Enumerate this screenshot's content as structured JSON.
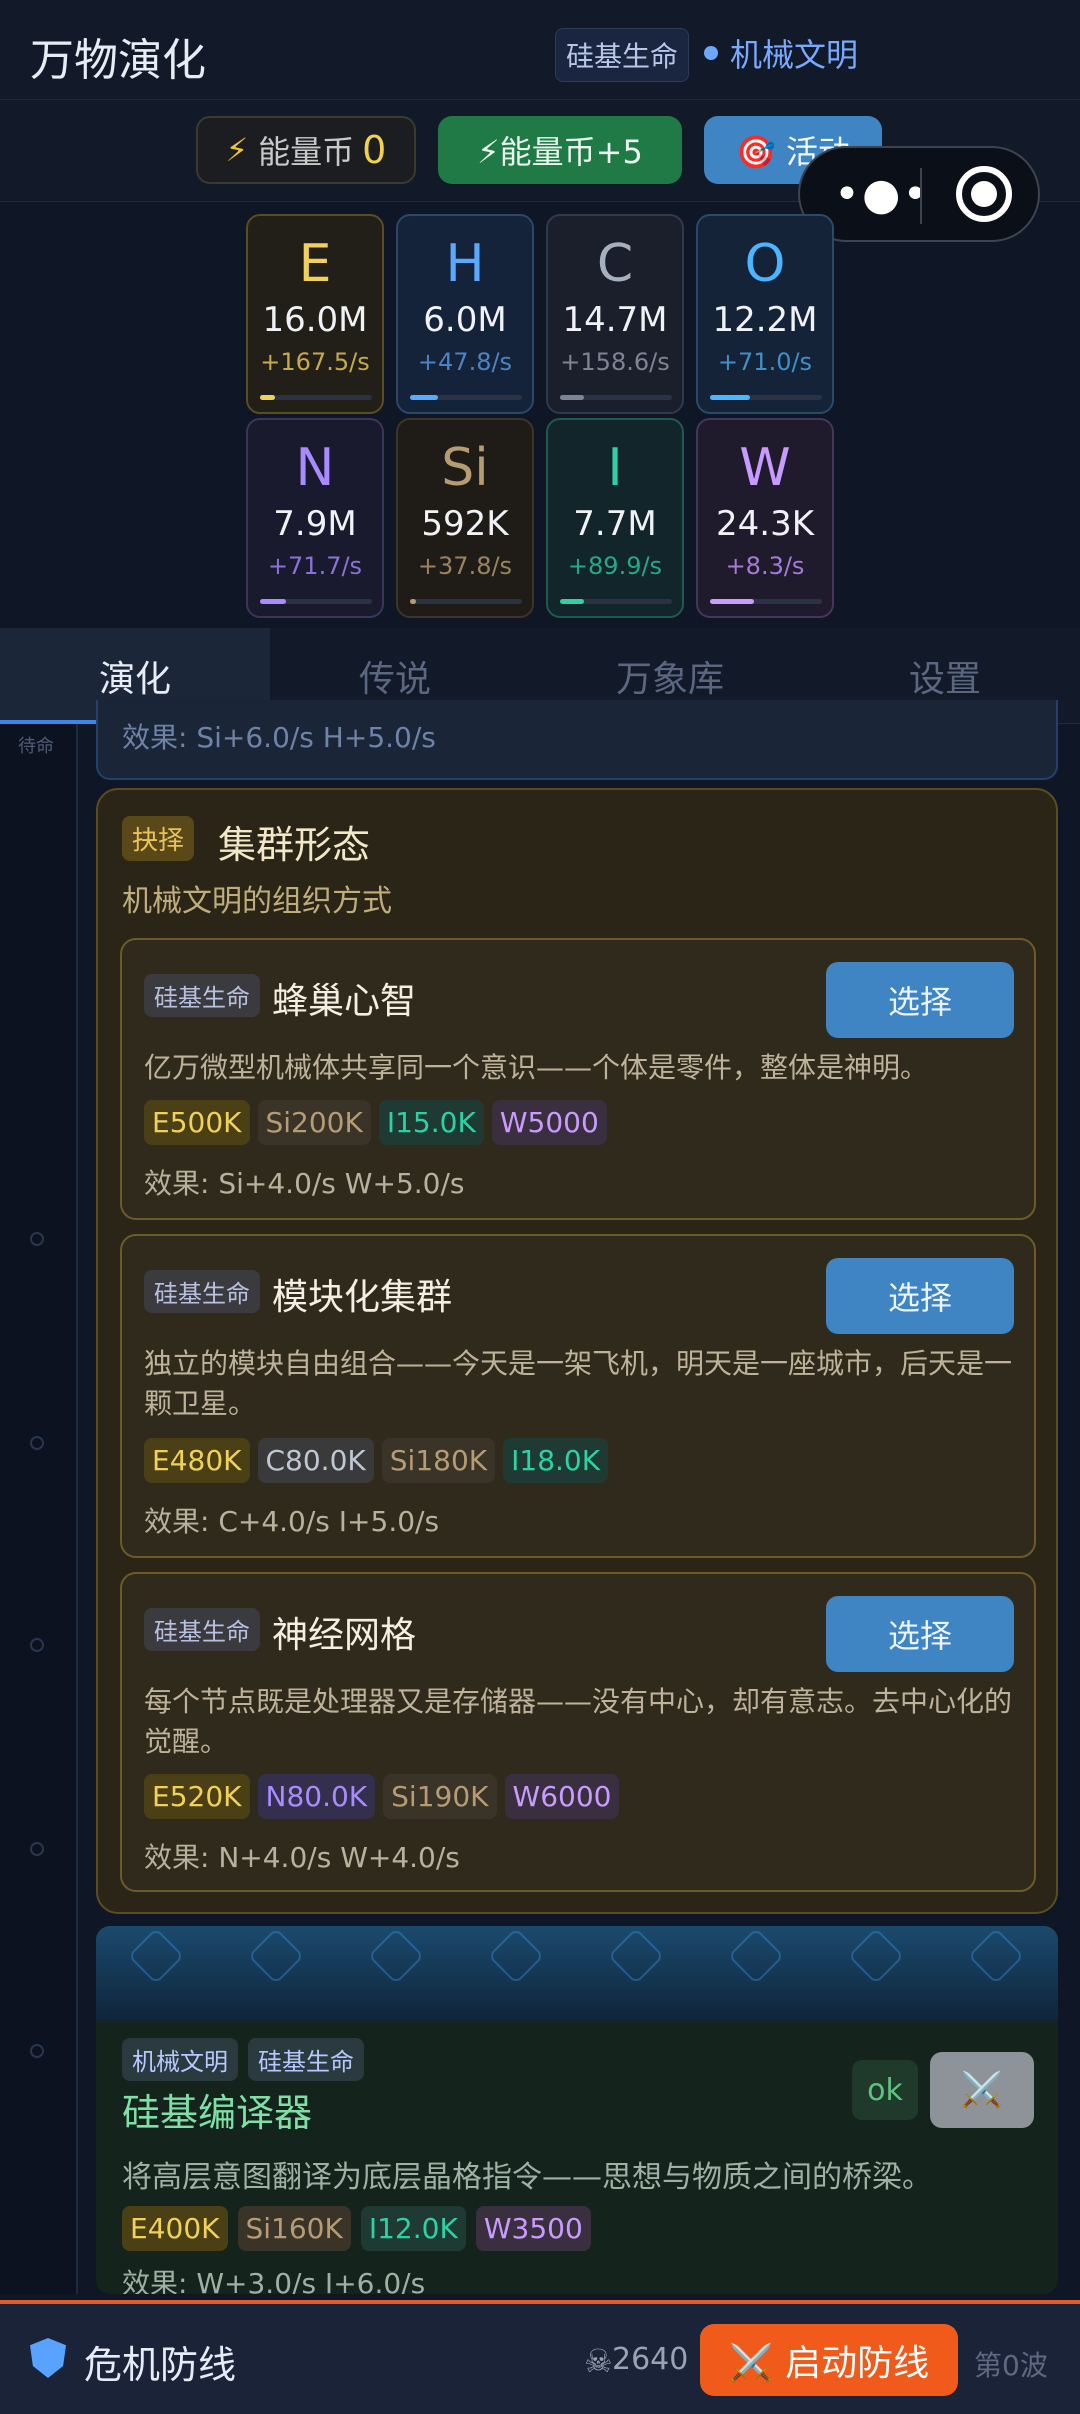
{
  "header": {
    "title": "万物演化",
    "tag": "硅基生命",
    "civ": "机械文明"
  },
  "topbar": {
    "energy_label": "能量币",
    "energy_value": "0",
    "plus_label": "⚡能量币+5",
    "activity_label": "🎯 活动"
  },
  "resources": [
    {
      "symbol": "E",
      "amount": "16.0M",
      "rate": "+167.5/s",
      "color": "#f0d25a",
      "fill": 0.12
    },
    {
      "symbol": "H",
      "amount": "6.0M",
      "rate": "+47.8/s",
      "color": "#5aa9ff",
      "fill": 0.12
    },
    {
      "symbol": "C",
      "amount": "14.7M",
      "rate": "+158.6/s",
      "color": "#a7b0bf",
      "fill": 0.12
    },
    {
      "symbol": "O",
      "amount": "12.2M",
      "rate": "+71.0/s",
      "color": "#4bb6ff",
      "fill": 0.2
    },
    {
      "symbol": "N",
      "amount": "7.9M",
      "rate": "+71.7/s",
      "color": "#a88bff",
      "fill": 0.12
    },
    {
      "symbol": "Si",
      "amount": "592K",
      "rate": "+37.8/s",
      "color": "#b59c72",
      "fill": 0.04
    },
    {
      "symbol": "I",
      "amount": "7.7M",
      "rate": "+89.9/s",
      "color": "#2ed1a6",
      "fill": 0.12
    },
    {
      "symbol": "W",
      "amount": "24.3K",
      "rate": "+8.3/s",
      "color": "#c99bff",
      "fill": 0.24
    }
  ],
  "tabs": [
    "演化",
    "传说",
    "万象库",
    "设置"
  ],
  "side": {
    "wait": "待命"
  },
  "prev": {
    "effect": "效果: Si+6.0/s  H+5.0/s"
  },
  "choice": {
    "tag": "抉择",
    "title": "集群形态",
    "desc": "机械文明的组织方式",
    "options": [
      {
        "civ": "硅基生命",
        "name": "蜂巢心智",
        "button": "选择",
        "text": "亿万微型机械体共享同一个意识——个体是零件，整体是神明。",
        "costs": [
          "E500K",
          "Si200K",
          "I15.0K",
          "W5000"
        ],
        "effect": "效果: Si+4.0/s  W+5.0/s"
      },
      {
        "civ": "硅基生命",
        "name": "模块化集群",
        "button": "选择",
        "text": "独立的模块自由组合——今天是一架飞机，明天是一座城市，后天是一颗卫星。",
        "costs": [
          "E480K",
          "C80.0K",
          "Si180K",
          "I18.0K"
        ],
        "effect": "效果: C+4.0/s  I+5.0/s"
      },
      {
        "civ": "硅基生命",
        "name": "神经网格",
        "button": "选择",
        "text": "每个节点既是处理器又是存储器——没有中心，却有意志。去中心化的觉醒。",
        "costs": [
          "E520K",
          "N80.0K",
          "Si190K",
          "W6000"
        ],
        "effect": "效果: N+4.0/s  W+4.0/s"
      }
    ]
  },
  "tech": {
    "tags": [
      "机械文明",
      "硅基生命"
    ],
    "name": "硅基编译器",
    "ok": "ok",
    "attack_icon": "⚔️",
    "desc": "将高层意图翻译为底层晶格指令——思想与物质之间的桥梁。",
    "costs": [
      "E400K",
      "Si160K",
      "I12.0K",
      "W3500"
    ],
    "effect": "效果: W+3.0/s  I+6.0/s"
  },
  "bottom": {
    "label": "危机防线",
    "count": "2640",
    "start": "⚔️ 启动防线",
    "wave": "第0波"
  }
}
